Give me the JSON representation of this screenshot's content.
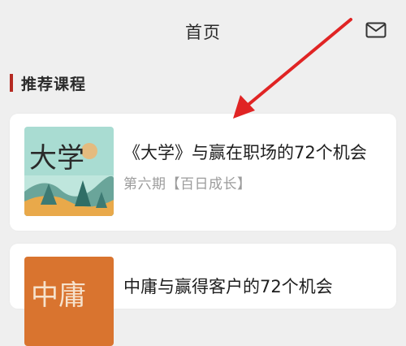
{
  "header": {
    "title": "首页",
    "mail_icon": "mail-icon"
  },
  "section": {
    "title": "推荐课程"
  },
  "courses": [
    {
      "title": "《大学》与赢在职场的72个机会",
      "subtitle": "第六期【百日成长】",
      "cover_text": "大学"
    },
    {
      "title": "中庸与赢得客户的72个机会",
      "cover_text": "中庸"
    }
  ],
  "colors": {
    "accent": "#b52a22",
    "annotation_arrow": "#e02424",
    "background": "#efefef"
  }
}
